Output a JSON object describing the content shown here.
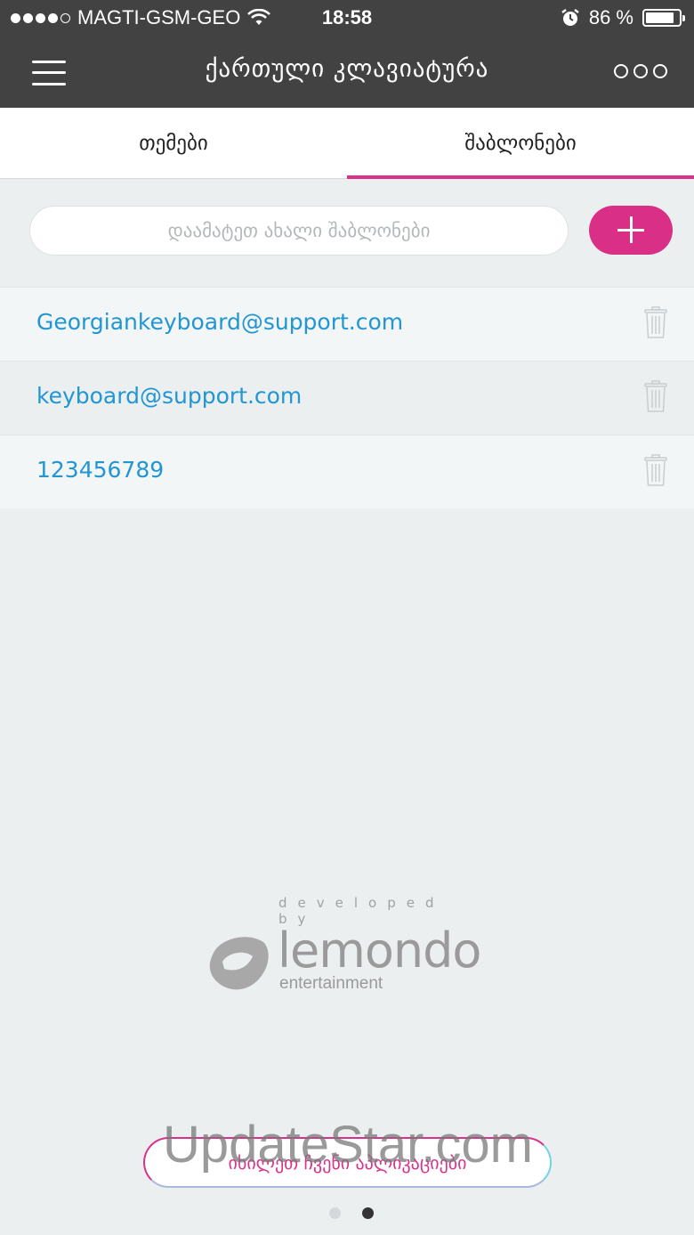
{
  "status_bar": {
    "carrier": "MAGTI-GSM-GEO",
    "time": "18:58",
    "battery": "86 %",
    "battery_level": 0.86
  },
  "header": {
    "title": "ქართული კლავიატურა"
  },
  "tabs": [
    {
      "label": "თემები",
      "active": false
    },
    {
      "label": "შაბლონები",
      "active": true
    }
  ],
  "search": {
    "placeholder": "დაამატეთ ახალი შაბლონები",
    "value": ""
  },
  "templates": [
    {
      "text": "Georgiankeyboard@support.com"
    },
    {
      "text": "keyboard@support.com"
    },
    {
      "text": "123456789"
    }
  ],
  "footer": {
    "developed_by": "developed by",
    "brand_name": "lemondo",
    "brand_sub": "entertainment",
    "see_apps_label": "იხილეთ ჩვენი აპლიკაციები",
    "pages": 2,
    "active_page": 2
  },
  "watermark": "UpdateStar.com",
  "colors": {
    "accent": "#da2f87",
    "link": "#2196d3",
    "header_bg": "#424242"
  }
}
